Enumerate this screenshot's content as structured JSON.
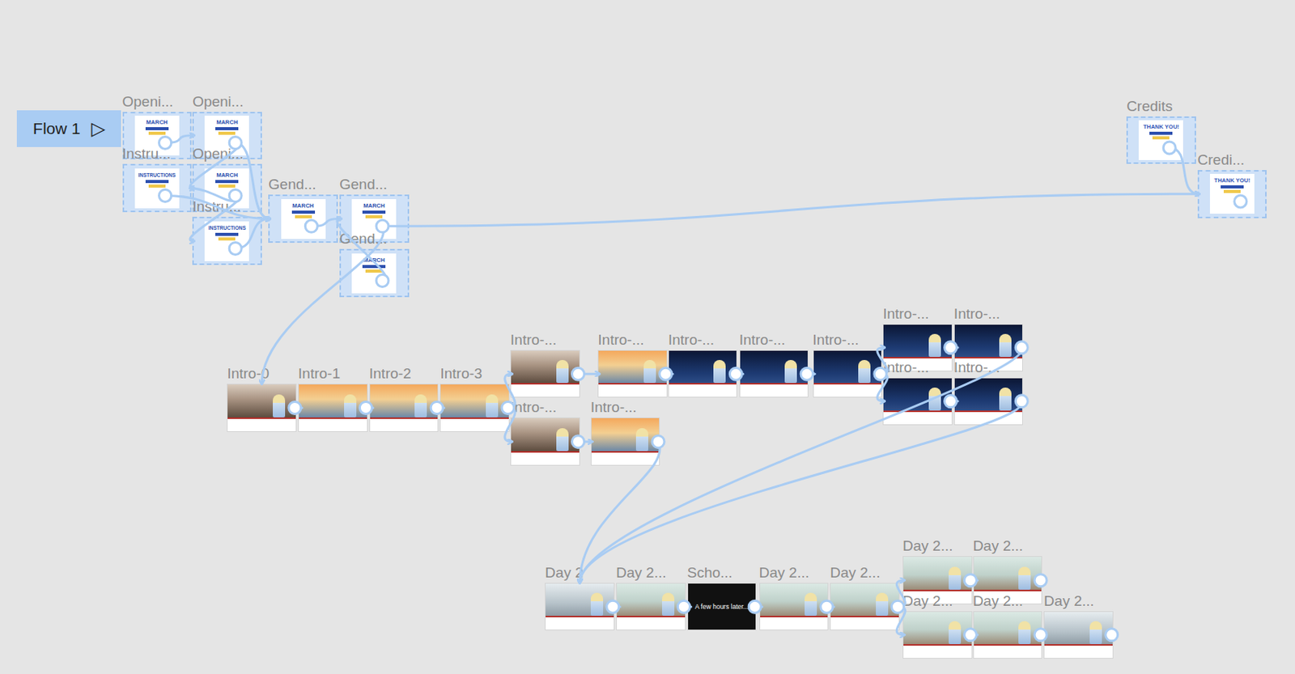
{
  "canvas": {
    "flow_button": {
      "label": "Flow 1",
      "icon": "▷"
    }
  },
  "nodes": [
    {
      "id": "op1",
      "label": "Openi...",
      "kind": "march",
      "screen_text": "MARCH",
      "selected": true
    },
    {
      "id": "op2",
      "label": "Openi...",
      "kind": "march",
      "screen_text": "MARCH",
      "selected": true
    },
    {
      "id": "ins1",
      "label": "Instru...",
      "kind": "instructions",
      "screen_text": "INSTRUCTIONS",
      "selected": true
    },
    {
      "id": "op3",
      "label": "Openi...",
      "kind": "march",
      "screen_text": "MARCH",
      "selected": true
    },
    {
      "id": "ins2",
      "label": "Instru...",
      "kind": "instructions",
      "screen_text": "INSTRUCTIONS",
      "selected": true
    },
    {
      "id": "gen1",
      "label": "Gend...",
      "kind": "march",
      "screen_text": "MARCH",
      "selected": true
    },
    {
      "id": "gen2",
      "label": "Gend...",
      "kind": "march",
      "screen_text": "MARCH",
      "selected": true
    },
    {
      "id": "gen3",
      "label": "Gend...",
      "kind": "march",
      "screen_text": "MARCH",
      "selected": true
    },
    {
      "id": "cr1",
      "label": "Credits",
      "kind": "thanks",
      "screen_text": "THANK YOU!",
      "selected": true
    },
    {
      "id": "cr2",
      "label": "Credi...",
      "kind": "thanks",
      "screen_text": "THANK YOU!",
      "selected": true
    },
    {
      "id": "i0",
      "label": "Intro-0",
      "kind": "rocks",
      "screen_text": "",
      "selected": false
    },
    {
      "id": "i1",
      "label": "Intro-1",
      "kind": "sunset",
      "screen_text": "",
      "selected": false
    },
    {
      "id": "i2",
      "label": "Intro-2",
      "kind": "sunset",
      "screen_text": "",
      "selected": false
    },
    {
      "id": "i3",
      "label": "Intro-3",
      "kind": "sunset",
      "screen_text": "",
      "selected": false
    },
    {
      "id": "i4a",
      "label": "Intro-...",
      "kind": "rocks",
      "screen_text": "",
      "selected": false
    },
    {
      "id": "i4b",
      "label": "Intro-...",
      "kind": "rocks",
      "screen_text": "",
      "selected": false
    },
    {
      "id": "i5a",
      "label": "Intro-...",
      "kind": "sunset",
      "screen_text": "",
      "selected": false
    },
    {
      "id": "i5b",
      "label": "Intro-...",
      "kind": "sunset",
      "screen_text": "",
      "selected": false
    },
    {
      "id": "i6",
      "label": "Intro-...",
      "kind": "night",
      "screen_text": "",
      "selected": false
    },
    {
      "id": "i7",
      "label": "Intro-...",
      "kind": "night",
      "screen_text": "",
      "selected": false
    },
    {
      "id": "i8",
      "label": "Intro-...",
      "kind": "night",
      "screen_text": "",
      "selected": false
    },
    {
      "id": "i9a",
      "label": "Intro-...",
      "kind": "night",
      "screen_text": "",
      "selected": false
    },
    {
      "id": "i10a",
      "label": "Intro-...",
      "kind": "night",
      "screen_text": "",
      "selected": false
    },
    {
      "id": "i9c",
      "label": "Intro-...",
      "kind": "night",
      "screen_text": "",
      "selected": false
    },
    {
      "id": "i10c",
      "label": "Intro-...",
      "kind": "night",
      "screen_text": "",
      "selected": false
    },
    {
      "id": "d0",
      "label": "Day 2",
      "kind": "hallway",
      "screen_text": "",
      "selected": false
    },
    {
      "id": "d1",
      "label": "Day 2...",
      "kind": "classroom",
      "screen_text": "",
      "selected": false
    },
    {
      "id": "d2",
      "label": "Scho...",
      "kind": "black",
      "screen_text": "A few hours later...",
      "selected": false
    },
    {
      "id": "d3",
      "label": "Day 2...",
      "kind": "classroom",
      "screen_text": "",
      "selected": false
    },
    {
      "id": "d4",
      "label": "Day 2...",
      "kind": "classroom",
      "screen_text": "",
      "selected": false
    },
    {
      "id": "d5a",
      "label": "Day 2...",
      "kind": "classroom",
      "screen_text": "",
      "selected": false
    },
    {
      "id": "d6a",
      "label": "Day 2...",
      "kind": "classroom",
      "screen_text": "",
      "selected": false
    },
    {
      "id": "d5c",
      "label": "Day 2...",
      "kind": "classroom",
      "screen_text": "",
      "selected": false
    },
    {
      "id": "d6c",
      "label": "Day 2...",
      "kind": "classroom",
      "screen_text": "",
      "selected": false
    },
    {
      "id": "d7",
      "label": "Day 2...",
      "kind": "hallway",
      "screen_text": "",
      "selected": false
    }
  ],
  "edges": [
    {
      "from": "op1",
      "to": "op2"
    },
    {
      "from": "op2",
      "to": "op3"
    },
    {
      "from": "op3",
      "to": "ins1"
    },
    {
      "from": "op3",
      "to": "ins2"
    },
    {
      "from": "op2",
      "to": "gen1"
    },
    {
      "from": "ins2",
      "to": "gen1"
    },
    {
      "from": "ins1",
      "to": "gen1"
    },
    {
      "from": "gen1",
      "to": "gen2"
    },
    {
      "from": "gen3",
      "to": "gen2"
    },
    {
      "from": "gen2",
      "to": "cr2"
    },
    {
      "from": "cr1",
      "to": "cr2"
    },
    {
      "from": "gen2",
      "to": "i0"
    },
    {
      "from": "i0",
      "to": "i1"
    },
    {
      "from": "i1",
      "to": "i2"
    },
    {
      "from": "i2",
      "to": "i3"
    },
    {
      "from": "i3",
      "to": "i4a"
    },
    {
      "from": "i3",
      "to": "i4b"
    },
    {
      "from": "i4a",
      "to": "i5a"
    },
    {
      "from": "i4b",
      "to": "i5b"
    },
    {
      "from": "i5a",
      "to": "i6"
    },
    {
      "from": "i6",
      "to": "i7"
    },
    {
      "from": "i7",
      "to": "i8"
    },
    {
      "from": "i8",
      "to": "i9c"
    },
    {
      "from": "i8",
      "to": "i9a"
    },
    {
      "from": "i9a",
      "to": "i10a"
    },
    {
      "from": "i9c",
      "to": "i10c"
    },
    {
      "from": "i5b",
      "to": "d0"
    },
    {
      "from": "i10a",
      "to": "d0"
    },
    {
      "from": "i10c",
      "to": "d0"
    },
    {
      "from": "d0",
      "to": "d1"
    },
    {
      "from": "d1",
      "to": "d2"
    },
    {
      "from": "d2",
      "to": "d3"
    },
    {
      "from": "d3",
      "to": "d4"
    },
    {
      "from": "d4",
      "to": "d5c"
    },
    {
      "from": "d4",
      "to": "d5a"
    },
    {
      "from": "d5a",
      "to": "d6a"
    },
    {
      "from": "d5c",
      "to": "d6c"
    }
  ]
}
